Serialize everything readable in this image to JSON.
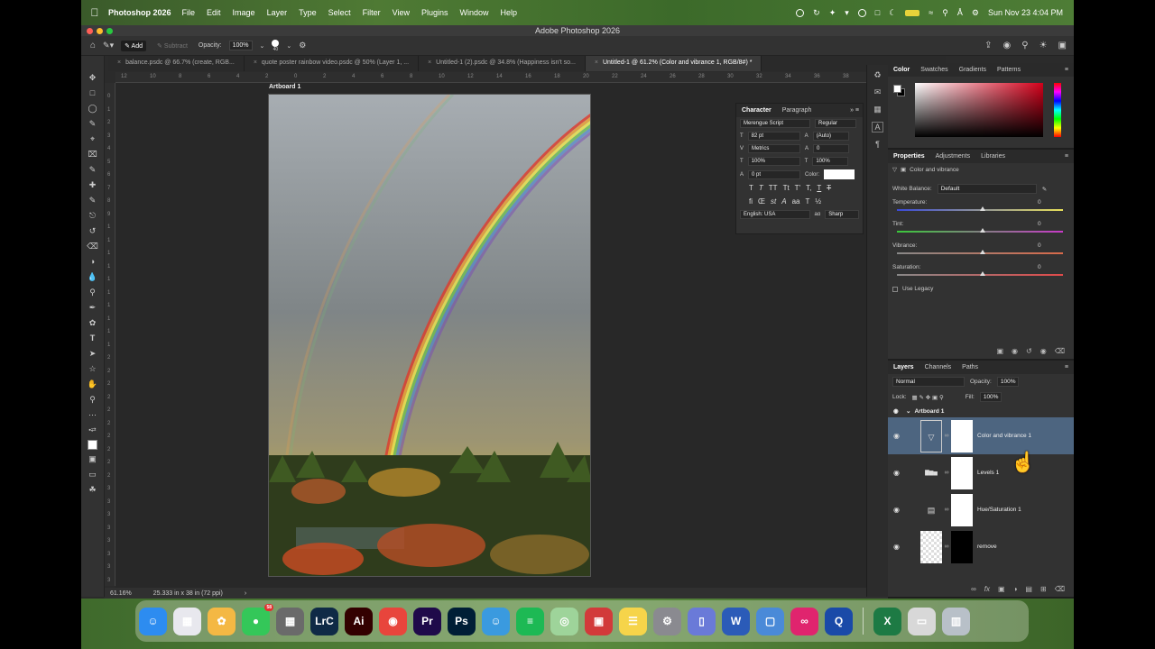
{
  "menubar": {
    "app_name": "Photoshop 2026",
    "menus": [
      "File",
      "Edit",
      "Image",
      "Layer",
      "Type",
      "Select",
      "Filter",
      "View",
      "Plugins",
      "Window",
      "Help"
    ],
    "clock": "Sun Nov 23  4:04 PM"
  },
  "window": {
    "title": "Adobe Photoshop 2026"
  },
  "options": {
    "add_label": "Add",
    "subtract_label": "Subtract",
    "opacity_label": "Opacity:",
    "opacity_value": "100%",
    "brush_size": "40"
  },
  "tabs": [
    "balance.psdc @ 66.7% (create, RGB...",
    "quote poster rainbow video.psdc @ 50% (Layer 1, ...",
    "Untitled-1 (2).psdc @ 34.8% (Happiness  isn't so...",
    "Untitled-1 @ 61.2% (Color and vibrance 1, RGB/8#) *"
  ],
  "ruler_h": [
    "12",
    "10",
    "8",
    "6",
    "4",
    "2",
    "0",
    "2",
    "4",
    "6",
    "8",
    "10",
    "12",
    "14",
    "16",
    "18",
    "20",
    "22",
    "24",
    "26",
    "28",
    "30",
    "32",
    "34",
    "36",
    "38",
    "40",
    "42",
    "44"
  ],
  "ruler_v": [
    "0",
    "1",
    "2",
    "3",
    "4",
    "5",
    "6",
    "7",
    "8",
    "9",
    "1",
    "1",
    "1",
    "1",
    "1",
    "1",
    "1",
    "1",
    "1",
    "1",
    "2",
    "2",
    "2",
    "2",
    "2",
    "2",
    "2",
    "2",
    "2",
    "2",
    "3",
    "3",
    "3",
    "3",
    "3",
    "3",
    "3",
    "3"
  ],
  "canvas": {
    "artboard_label": "Artboard 1"
  },
  "status": {
    "zoom": "61.16%",
    "doc_size": "25.333 in x 38 in (72 ppi)"
  },
  "character": {
    "tab_character": "Character",
    "tab_paragraph": "Paragraph",
    "font_family": "Merengue Script",
    "font_style": "Regular",
    "font_size": "82 pt",
    "leading": "(Auto)",
    "kerning": "Metrics",
    "tracking": "0",
    "vscale": "100%",
    "hscale": "100%",
    "baseline": "0 pt",
    "color_label": "Color:",
    "language": "English: USA",
    "antialias_label": "aɑ",
    "antialias": "Sharp"
  },
  "color_panel": {
    "tabs": [
      "Color",
      "Swatches",
      "Gradients",
      "Patterns"
    ]
  },
  "properties": {
    "tabs": [
      "Properties",
      "Adjustments",
      "Libraries"
    ],
    "title": "Color and vibrance",
    "white_balance_label": "White Balance:",
    "white_balance_value": "Default",
    "sliders": [
      {
        "label": "Temperature:",
        "value": "0"
      },
      {
        "label": "Tint:",
        "value": "0"
      },
      {
        "label": "Vibrance:",
        "value": "0"
      },
      {
        "label": "Saturation:",
        "value": "0"
      }
    ],
    "use_legacy": "Use Legacy"
  },
  "layers_panel": {
    "tabs": [
      "Layers",
      "Channels",
      "Paths"
    ],
    "blend_mode": "Normal",
    "opacity_label": "Opacity:",
    "opacity_value": "100%",
    "lock_label": "Lock:",
    "fill_label": "Fill:",
    "fill_value": "100%",
    "group_name": "Artboard 1",
    "layers": [
      {
        "name": "Color and vibrance 1",
        "icon": "▽"
      },
      {
        "name": "Levels 1",
        "icon": "▇▆▅"
      },
      {
        "name": "Hue/Saturation 1",
        "icon": "▤"
      },
      {
        "name": "remove",
        "icon": ""
      }
    ]
  },
  "dock": {
    "messages_badge": "58",
    "apps": [
      {
        "name": "Finder",
        "label": "☺",
        "color": "#2d8cf0"
      },
      {
        "name": "Launchpad",
        "label": "▦",
        "color": "#e8e8ee"
      },
      {
        "name": "Photos",
        "label": "✿",
        "color": "#f4b844"
      },
      {
        "name": "Messages",
        "label": "●",
        "color": "#34c759"
      },
      {
        "name": "Calculator",
        "label": "▦",
        "color": "#6a6a6a"
      },
      {
        "name": "Lightroom Classic",
        "label": "LrC",
        "color": "#0f2a46"
      },
      {
        "name": "Illustrator",
        "label": "Ai",
        "color": "#330000"
      },
      {
        "name": "Chrome",
        "label": "◉",
        "color": "#e8453c"
      },
      {
        "name": "Premiere Pro",
        "label": "Pr",
        "color": "#1f0a4a"
      },
      {
        "name": "Photoshop",
        "label": "Ps",
        "color": "#001e36"
      },
      {
        "name": "Waze",
        "label": "☺",
        "color": "#3a9adf"
      },
      {
        "name": "Spotify",
        "label": "≡",
        "color": "#1db954"
      },
      {
        "name": "Preview",
        "label": "◎",
        "color": "#9ed49a"
      },
      {
        "name": "Photo Booth",
        "label": "▣",
        "color": "#d23a3a"
      },
      {
        "name": "Notes",
        "label": "☰",
        "color": "#f6d44a"
      },
      {
        "name": "System Settings",
        "label": "⚙",
        "color": "#8a8a90"
      },
      {
        "name": "iPhone Mirroring",
        "label": "▯",
        "color": "#6a7ad8"
      },
      {
        "name": "Word",
        "label": "W",
        "color": "#2b5bb8"
      },
      {
        "name": "Screen Sharing",
        "label": "▢",
        "color": "#4a8ad8"
      },
      {
        "name": "Creative Cloud",
        "label": "∞",
        "color": "#e0246e"
      },
      {
        "name": "QuickTime",
        "label": "Q",
        "color": "#1a4aa8"
      },
      {
        "name": "Excel",
        "label": "X",
        "color": "#1d7a44"
      },
      {
        "name": "Documents",
        "label": "▭",
        "color": "#d8d8d8"
      },
      {
        "name": "Trash",
        "label": "▥",
        "color": "#b8c0c8"
      }
    ]
  }
}
